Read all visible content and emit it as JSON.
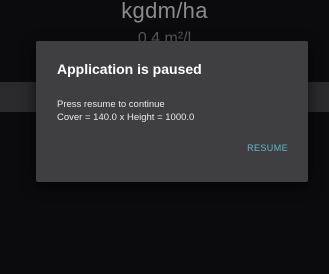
{
  "background": {
    "title": "kgdm/ha",
    "subtitle": "0.4 m²/l"
  },
  "dialog": {
    "title": "Application is paused",
    "message_line1": "Press resume to continue",
    "message_line2": "Cover = 140.0 x Height = 1000.0",
    "resume_label": "RESUME"
  },
  "colors": {
    "background": "#0b0b0e",
    "dialog": "#3f3f42",
    "accent": "#5fb8c8"
  }
}
